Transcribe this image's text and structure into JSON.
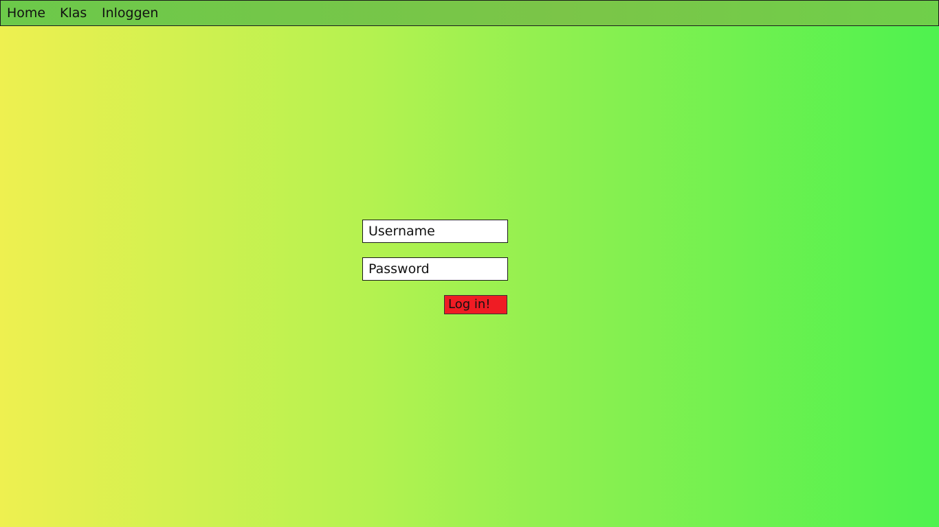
{
  "nav": {
    "items": [
      {
        "label": "Home"
      },
      {
        "label": "Klas"
      },
      {
        "label": "Inloggen"
      }
    ]
  },
  "login": {
    "username_placeholder": "Username",
    "password_placeholder": "Password",
    "submit_label": "Log in!"
  },
  "colors": {
    "background_gradient_start": "#eef050",
    "background_gradient_end": "#4ef24f",
    "navbar": "#78c748",
    "button": "#ef1c24"
  }
}
